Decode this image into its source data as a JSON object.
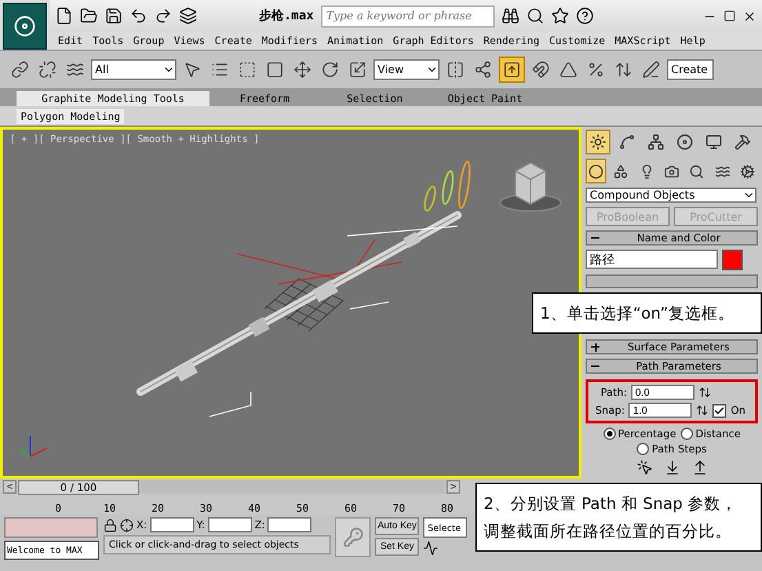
{
  "title_bar": {
    "title": "步枪.max",
    "search": {
      "placeholder": "Type a keyword or phrase"
    }
  },
  "menu": [
    "Edit",
    "Tools",
    "Group",
    "Views",
    "Create",
    "Modifiers",
    "Animation",
    "Graph Editors",
    "Rendering",
    "Customize",
    "MAXScript",
    "Help"
  ],
  "toolbar": {
    "selection_filter": "All",
    "reference_coord": "View",
    "named_selection": "Create",
    "manipulate_on": true
  },
  "ribbon": {
    "tabs": [
      {
        "label": "Graphite Modeling Tools",
        "selected": true
      },
      {
        "label": "Freeform",
        "selected": false
      },
      {
        "label": "Selection",
        "selected": false
      },
      {
        "label": "Object Paint",
        "selected": false
      }
    ],
    "panel": "Polygon Modeling"
  },
  "viewport": {
    "label": "[ + ][ Perspective ][ Smooth + Highlights ]",
    "active": true
  },
  "command_panel": {
    "tabs": [
      {
        "kind": "create",
        "selected": true
      },
      {
        "kind": "modify",
        "selected": false
      },
      {
        "kind": "hierarchy",
        "selected": false
      },
      {
        "kind": "motion",
        "selected": false
      },
      {
        "kind": "display",
        "selected": false
      },
      {
        "kind": "utilities",
        "selected": false
      }
    ],
    "categories": [
      {
        "kind": "geometry",
        "selected": true
      },
      {
        "kind": "shapes",
        "selected": false
      },
      {
        "kind": "lights",
        "selected": false
      },
      {
        "kind": "cameras",
        "selected": false
      },
      {
        "kind": "helpers",
        "selected": false
      },
      {
        "kind": "spacewarps",
        "selected": false
      },
      {
        "kind": "systems",
        "selected": false
      }
    ],
    "object_type": "Compound Objects",
    "buttons": [
      {
        "label": "ProBoolean",
        "disabled": true
      },
      {
        "label": "ProCutter",
        "disabled": true
      }
    ],
    "name_and_color": {
      "title": "Name and Color",
      "expanded": true,
      "name": "路径",
      "color": "#ff0000"
    },
    "surface_parameters": {
      "title": "Surface Parameters",
      "expanded": false
    },
    "path_parameters": {
      "title": "Path Parameters",
      "expanded": true,
      "fields": [
        {
          "label": "Path:",
          "value": "0.0"
        },
        {
          "label": "Snap:",
          "value": "1.0"
        }
      ],
      "snap_on": {
        "label": "On",
        "checked": true
      },
      "modes": [
        {
          "label": "Percentage",
          "selected": true
        },
        {
          "label": "Distance",
          "selected": false
        },
        {
          "label": "Path Steps",
          "selected": false
        }
      ]
    }
  },
  "time_slider": {
    "position": "0 / 100",
    "prev": "<",
    "next": ">",
    "level": 0
  },
  "track_bar": {
    "ticks": [
      "0",
      "10",
      "20",
      "30",
      "40",
      "50",
      "60",
      "70",
      "80"
    ]
  },
  "status_bar": {
    "welcome": "Welcome to MAX",
    "prompt": "Click or click-and-drag to select objects",
    "coords": [
      {
        "label": "X:"
      },
      {
        "label": "Y:"
      },
      {
        "label": "Z:"
      }
    ],
    "auto_key": "Auto Key",
    "set_key": "Set Key",
    "key_filter": "Selecte"
  },
  "callouts": [
    {
      "lines": [
        "1、单击选择“on”复选框。"
      ]
    },
    {
      "lines": [
        "2、分别设置 Path 和 Snap 参数，",
        "调整截面所在路径位置的百分比。"
      ]
    }
  ]
}
